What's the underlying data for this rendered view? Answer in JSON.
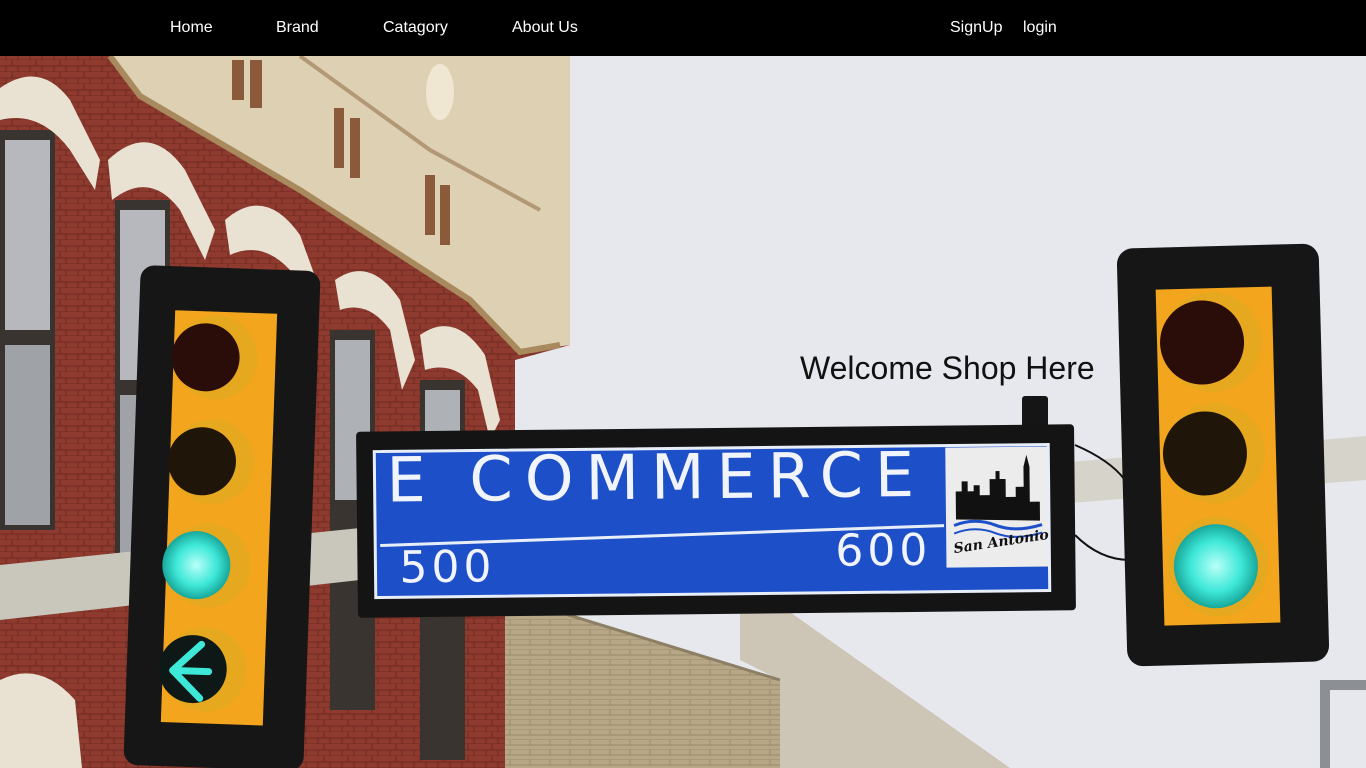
{
  "nav": {
    "home": "Home",
    "brand": "Brand",
    "category": "Catagory",
    "about": "About Us",
    "signup": "SignUp",
    "login": "login"
  },
  "hero": {
    "welcome": "Welcome Shop Here",
    "sign": {
      "street": "E COMMERCE",
      "block_left": "500",
      "block_right": "600",
      "city": "San Antonio"
    }
  },
  "colors": {
    "nav_bg": "#000000",
    "nav_text": "#ffffff",
    "sign_blue": "#1d4fc9",
    "light_green": "#3ee8d8",
    "light_housing": "#f2a51d"
  }
}
